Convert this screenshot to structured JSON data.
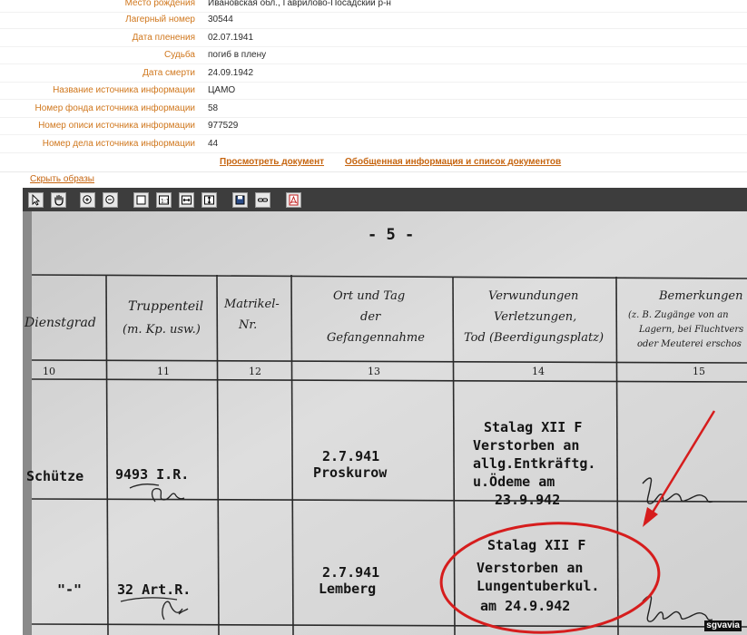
{
  "record": {
    "rows": [
      {
        "label": "Место рождения",
        "value": "Ивановская обл., Гаврилово-Посадский р-н"
      },
      {
        "label": "Лагерный номер",
        "value": "30544"
      },
      {
        "label": "Дата пленения",
        "value": "02.07.1941"
      },
      {
        "label": "Судьба",
        "value": "погиб в плену"
      },
      {
        "label": "Дата смерти",
        "value": "24.09.1942"
      },
      {
        "label": "Название источника информации",
        "value": "ЦАМО"
      },
      {
        "label": "Номер фонда источника информации",
        "value": "58"
      },
      {
        "label": "Номер описи источника информации",
        "value": "977529"
      },
      {
        "label": "Номер дела источника информации",
        "value": "44"
      }
    ]
  },
  "links": {
    "view_document": "Просмотреть документ",
    "summary_info": "Обобщенная информация и список документов",
    "hide_images": "Скрыть образы"
  },
  "viewer": {
    "tools": [
      "select-arrow-icon",
      "hand-pan-icon",
      "zoom-in-icon",
      "zoom-out-icon",
      "fit-page-icon",
      "actual-size-icon",
      "fit-width-icon",
      "fit-height-icon",
      "save-icon",
      "link-icon",
      "pdf-icon"
    ]
  },
  "document": {
    "page_marker": "- 5 -",
    "columns": [
      {
        "num": "10",
        "header": [
          "Dienstgrad"
        ]
      },
      {
        "num": "11",
        "header": [
          "Truppenteil",
          "(m. Kp. usw.)"
        ]
      },
      {
        "num": "12",
        "header": [
          "Matrikel-",
          "Nr."
        ]
      },
      {
        "num": "13",
        "header": [
          "Ort und Tag",
          "der",
          "Gefangennahme"
        ]
      },
      {
        "num": "14",
        "header": [
          "Verwundungen",
          "Verletzungen,",
          "Tod (Beerdigungsplatz)"
        ]
      },
      {
        "num": "15",
        "header": [
          "Bemerkungen",
          "(z. B. Zugänge von an",
          "Lagern, bei Fluchtvers",
          "oder Meuterei erschos"
        ]
      }
    ],
    "rows": [
      {
        "rank": "Schütze",
        "unit": "9493 I.R.",
        "capture": [
          "2.7.941",
          "Proskurow"
        ],
        "death": [
          "Stalag XII F",
          "Verstorben an",
          "allg.Entkräftg.",
          "u.Ödeme  am",
          "23.9.942"
        ]
      },
      {
        "rank": "\"-\"",
        "unit": "32 Art.R.",
        "capture": [
          "2.7.941",
          "Lemberg"
        ],
        "death": [
          "Stalag XII F",
          "Verstorben an",
          "Lungentuberkul.",
          "am  24.9.942"
        ]
      }
    ],
    "watermark": "sgvavia"
  },
  "colors": {
    "label": "#d0771d",
    "link": "#c66510",
    "annotation": "#d61d1d"
  }
}
